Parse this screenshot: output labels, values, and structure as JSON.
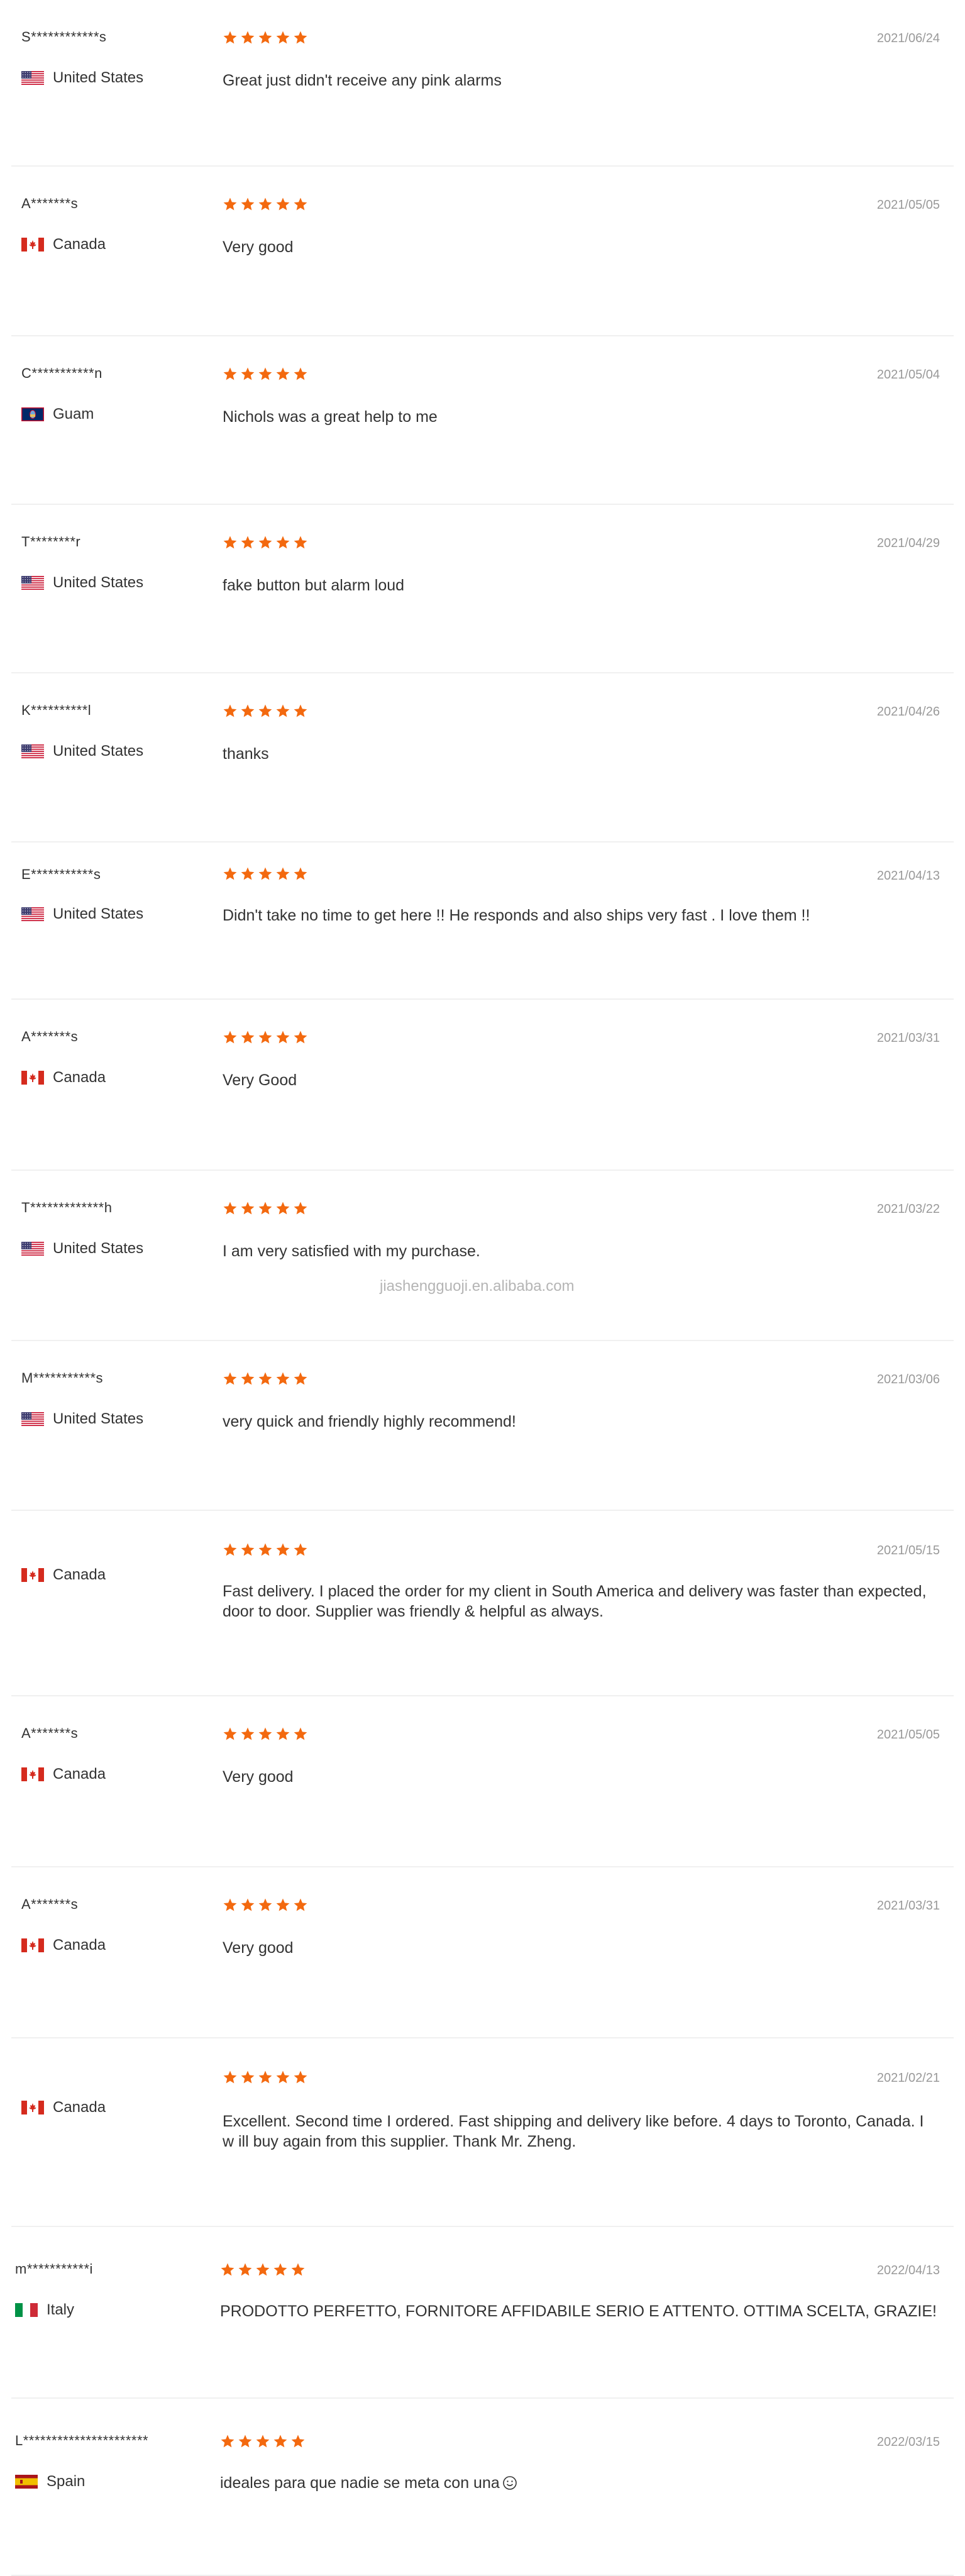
{
  "colors": {
    "star": "#f3690f",
    "date": "#999999",
    "text": "#333333",
    "divider": "#f0f0f0",
    "watermark": "#b5b5b5"
  },
  "watermark": "jiashengguoji.en.alibaba.com",
  "reviews": [
    {
      "name": "S************s",
      "country": "United States",
      "flag": "us",
      "rating": 5,
      "date": "2021/06/24",
      "comment": "Great just didn't receive any pink alarms"
    },
    {
      "name": "A*******s",
      "country": "Canada",
      "flag": "ca",
      "rating": 5,
      "date": "2021/05/05",
      "comment": "Very good"
    },
    {
      "name": "C***********n",
      "country": "Guam",
      "flag": "gu",
      "rating": 5,
      "date": "2021/05/04",
      "comment": "Nichols was a great help to me"
    },
    {
      "name": "T********r",
      "country": "United States",
      "flag": "us",
      "rating": 5,
      "date": "2021/04/29",
      "comment": "fake button but alarm loud"
    },
    {
      "name": "K**********l",
      "country": "United States",
      "flag": "us",
      "rating": 5,
      "date": "2021/04/26",
      "comment": "thanks"
    },
    {
      "name": "E***********s",
      "country": "United States",
      "flag": "us",
      "rating": 5,
      "date": "2021/04/13",
      "comment": "Didn't take no time to get here !! He responds and also ships very fast . I love them !!"
    },
    {
      "name": "A*******s",
      "country": "Canada",
      "flag": "ca",
      "rating": 5,
      "date": "2021/03/31",
      "comment": "Very Good"
    },
    {
      "name": "T*************h",
      "country": "United States",
      "flag": "us",
      "rating": 5,
      "date": "2021/03/22",
      "comment": "I am very satisfied with my purchase."
    },
    {
      "name": "M***********s",
      "country": "United States",
      "flag": "us",
      "rating": 5,
      "date": "2021/03/06",
      "comment": "very quick and friendly highly recommend!"
    },
    {
      "name": "",
      "country": "Canada",
      "flag": "ca",
      "rating": 5,
      "date": "2021/05/15",
      "comment": "Fast delivery. I placed the order for my client in South America and delivery was faster than expected, door to door. Supplier was friendly & helpful as always."
    },
    {
      "name": "A*******s",
      "country": "Canada",
      "flag": "ca",
      "rating": 5,
      "date": "2021/05/05",
      "comment": "Very good"
    },
    {
      "name": "A*******s",
      "country": "Canada",
      "flag": "ca",
      "rating": 5,
      "date": "2021/03/31",
      "comment": "Very good"
    },
    {
      "name": "",
      "country": "Canada",
      "flag": "ca",
      "rating": 5,
      "date": "2021/02/21",
      "comment": "Excellent. Second time I ordered. Fast shipping and delivery like before. 4 days to Toronto, Canada. I w ill buy again from this supplier. Thank Mr. Zheng."
    },
    {
      "name": "m***********i",
      "country": "Italy",
      "flag": "it",
      "rating": 5,
      "date": "2022/04/13",
      "comment": "PRODOTTO PERFETTO, FORNITORE AFFIDABILE SERIO E ATTENTO. OTTIMA SCELTA, GRAZIE!"
    },
    {
      "name": "L**********************",
      "country": "Spain",
      "flag": "es",
      "rating": 5,
      "date": "2022/03/15",
      "comment": "ideales para que nadie se meta con una",
      "emoji": "smiling-face-icon"
    }
  ]
}
